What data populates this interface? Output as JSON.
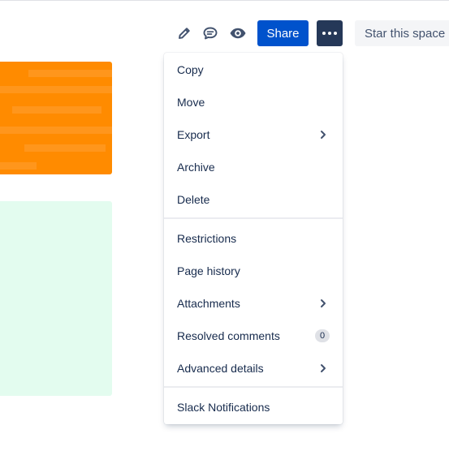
{
  "toolbar": {
    "edit_icon": "pencil-icon",
    "comment_icon": "comment-icon",
    "watch_icon": "eye-icon",
    "share_label": "Share",
    "more_icon": "more-horizontal-icon",
    "star_label": "Star this space",
    "share_color": "#0052cc",
    "more_color": "#253858"
  },
  "menu": {
    "groups": [
      {
        "items": [
          {
            "label": "Copy"
          },
          {
            "label": "Move"
          },
          {
            "label": "Export",
            "submenu": true
          },
          {
            "label": "Archive"
          },
          {
            "label": "Delete"
          }
        ]
      },
      {
        "items": [
          {
            "label": "Restrictions"
          },
          {
            "label": "Page history"
          },
          {
            "label": "Attachments",
            "submenu": true
          },
          {
            "label": "Resolved comments",
            "badge": "0"
          },
          {
            "label": "Advanced details",
            "submenu": true
          }
        ]
      },
      {
        "items": [
          {
            "label": "Slack Notifications"
          }
        ]
      }
    ]
  },
  "colors": {
    "orange_block": "#ff8b00",
    "green_block": "#e3fcef"
  }
}
